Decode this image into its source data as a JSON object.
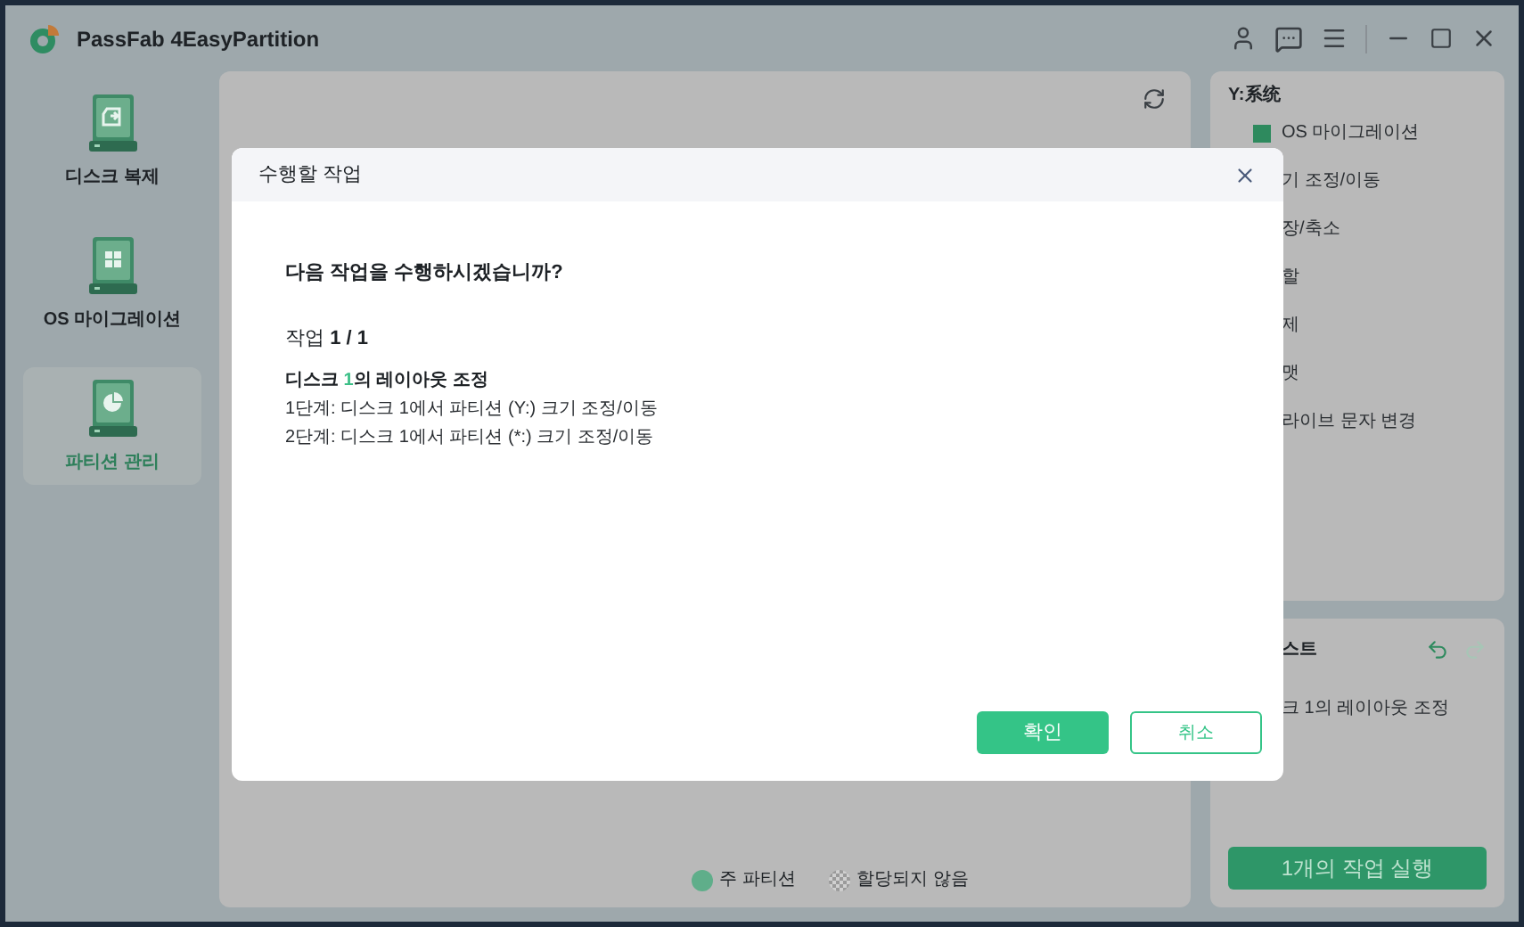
{
  "window": {
    "title": "PassFab 4EasyPartition"
  },
  "sidebar": {
    "items": [
      {
        "label": "디스크 복제",
        "kind": "clone",
        "selected": false
      },
      {
        "label": "OS 마이그레이션",
        "kind": "grid",
        "selected": false
      },
      {
        "label": "파티션 관리",
        "kind": "pie",
        "selected": true
      }
    ]
  },
  "legend": [
    {
      "label": "주 파티션",
      "kind": "solid",
      "color": "#5fae8a"
    },
    {
      "label": "할당되지 않음",
      "kind": "pattern",
      "color": "#9a9a9a"
    }
  ],
  "right_panel": {
    "title": "Y:系统",
    "items": [
      {
        "label": "OS 마이그레이션",
        "kind": "migrate"
      },
      {
        "label": "기 조정/이동",
        "kind": "plain"
      },
      {
        "label": "장/축소",
        "kind": "plain"
      },
      {
        "label": "할",
        "kind": "plain"
      },
      {
        "label": "제",
        "kind": "plain"
      },
      {
        "label": "맷",
        "kind": "plain"
      },
      {
        "label": "라이브 문자 변경",
        "kind": "plain"
      }
    ]
  },
  "operations": {
    "title": "스트",
    "items": [
      "크 1의 레이아웃 조정"
    ],
    "run_button": "1개의 작업 실행"
  },
  "dialog": {
    "title": "수행할 작업",
    "question": "다음 작업을 수행하시겠습니까?",
    "counter": "작업 **1 / 1**",
    "disk_title": {
      "before": "디스크 ",
      "highlight": "1",
      "after": "의 레이아웃 조정"
    },
    "steps": [
      "1단계: 디스크 1에서 파티션 (Y:) 크기 조정/이동",
      "2단계: 디스크 1에서 파티션 (*:) 크기 조정/이동"
    ],
    "confirm": "확인",
    "cancel": "취소"
  }
}
